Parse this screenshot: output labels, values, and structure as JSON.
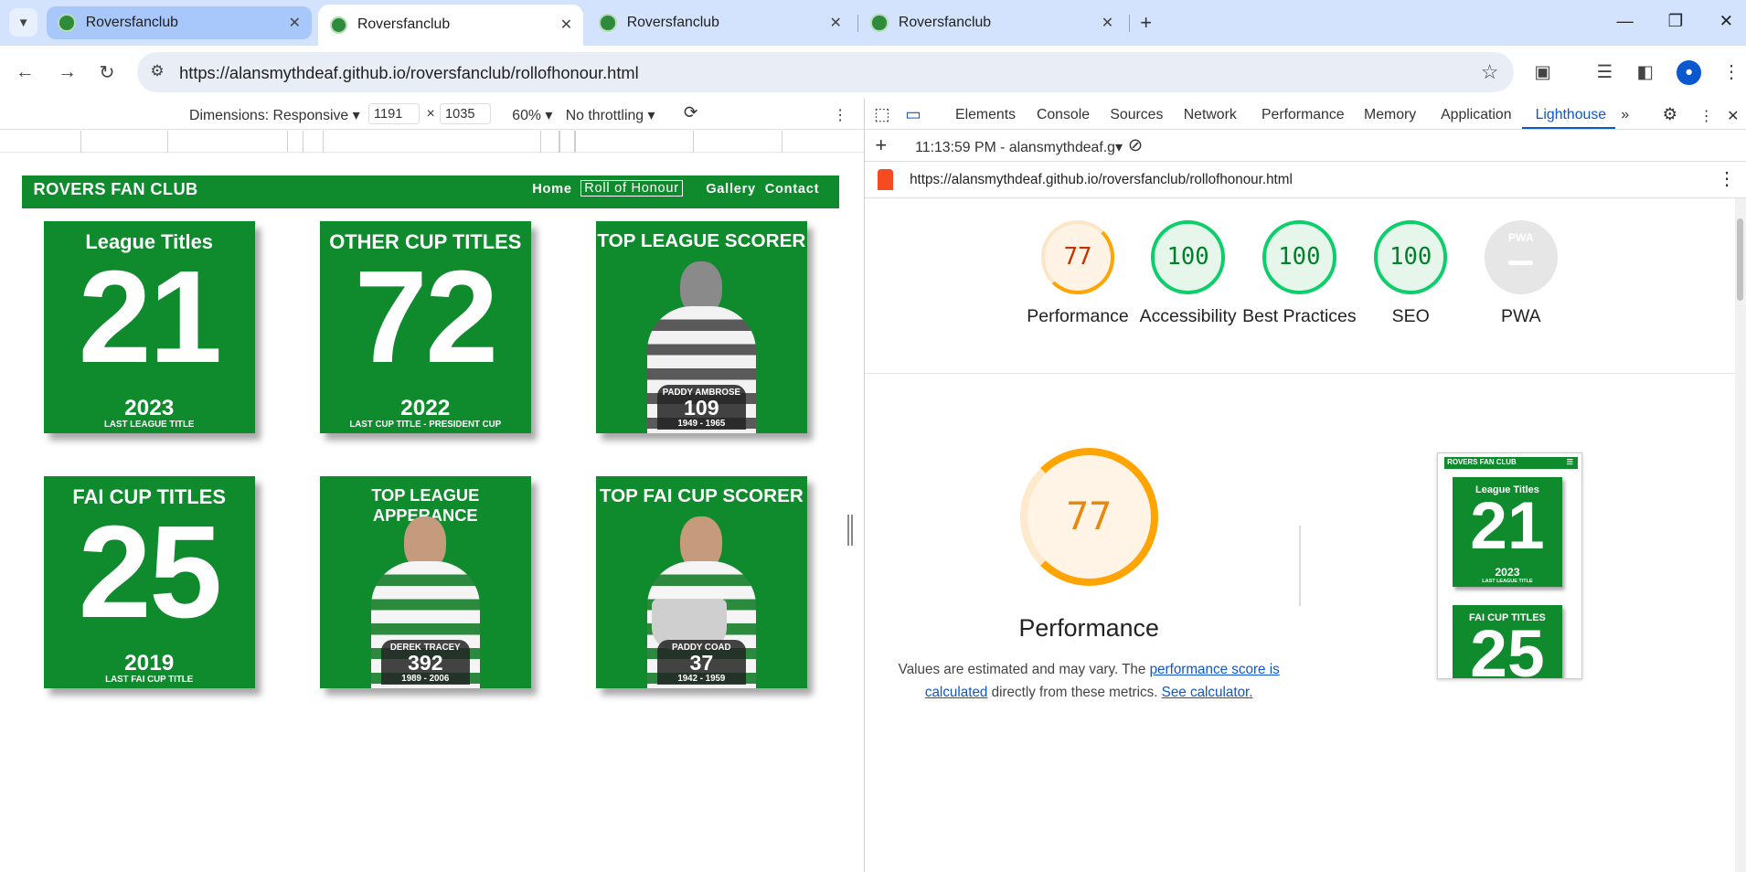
{
  "browser": {
    "tabs": [
      {
        "title": "Roversfanclub"
      },
      {
        "title": "Roversfanclub"
      },
      {
        "title": "Roversfanclub"
      },
      {
        "title": "Roversfanclub"
      }
    ],
    "url": "https://alansmythdeaf.github.io/roversfanclub/rollofhonour.html",
    "avatar_initial": "●"
  },
  "device_toolbar": {
    "dimensions_label": "Dimensions: Responsive",
    "width": "1191",
    "times": "×",
    "height": "1035",
    "zoom": "60%",
    "throttling": "No throttling"
  },
  "site": {
    "logo": "ROVERS FAN CLUB",
    "nav": [
      "Home",
      "Roll of Honour",
      "Gallery",
      "Contact"
    ],
    "cards": [
      {
        "title": "League Titles",
        "number": "21",
        "year": "2023",
        "sub": "LAST LEAGUE TITLE"
      },
      {
        "title": "OTHER CUP TITLES",
        "number": "72",
        "year": "2022",
        "sub": "LAST  CUP TITLE - PRESIDENT CUP"
      },
      {
        "title": "TOP LEAGUE SCORER",
        "player": "PADDY AMBROSE",
        "value": "109",
        "years": "1949 - 1965"
      },
      {
        "title": "FAI CUP TITLES",
        "number": "25",
        "year": "2019",
        "sub": "LAST  FAI CUP TITLE"
      },
      {
        "title": "TOP LEAGUE APPERANCE",
        "player": "DEREK TRACEY",
        "value": "392",
        "years": "1989 - 2006"
      },
      {
        "title": "TOP FAI CUP SCORER",
        "player": "PADDY COAD",
        "value": "37",
        "years": "1942 - 1959"
      }
    ]
  },
  "devtools": {
    "tabs": [
      "Elements",
      "Console",
      "Sources",
      "Network",
      "Performance",
      "Memory",
      "Application",
      "Lighthouse"
    ],
    "active_tab": "Lighthouse",
    "report_time": "11:13:59 PM - alansmythdeaf.g",
    "report_url": "https://alansmythdeaf.github.io/roversfanclub/rollofhonour.html",
    "scores": [
      {
        "label": "Performance",
        "value": "77"
      },
      {
        "label": "Accessibility",
        "value": "100"
      },
      {
        "label": "Best Practices",
        "value": "100"
      },
      {
        "label": "SEO",
        "value": "100"
      },
      {
        "label": "PWA",
        "value": "PWA"
      }
    ],
    "performance": {
      "score": "77",
      "title": "Performance",
      "note_pre": "Values are estimated and may vary. The ",
      "note_link1": "performance score is calculated",
      "note_mid": " directly from these metrics. ",
      "note_link2": "See calculator."
    },
    "thumbnail": {
      "logo": "ROVERS FAN CLUB",
      "card1_title": "League Titles",
      "card1_number": "21",
      "card1_year": "2023",
      "card1_sub": "LAST LEAGUE TITLE",
      "card2_title": "FAI CUP TITLES",
      "card2_number": "25"
    }
  },
  "colors": {
    "club_green": "#0f8a2d",
    "devtools_accent": "#0b57d0",
    "score_good": "#0cce6b",
    "score_average": "#ffa400"
  }
}
